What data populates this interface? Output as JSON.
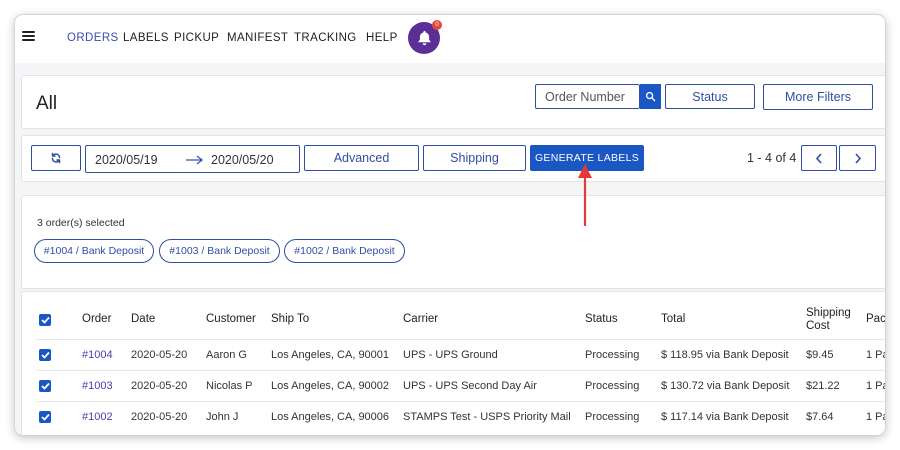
{
  "nav": {
    "items": [
      "ORDERS",
      "LABELS",
      "PICKUP",
      "MANIFEST",
      "TRACKING",
      "HELP"
    ],
    "active": "ORDERS",
    "notification_count": "0",
    "colors": {
      "active": "#3a4db1",
      "bell": "#5b2f97",
      "badge": "#e0483a"
    },
    "icons": {
      "menu": "hamburger-icon",
      "notifications": "bell-icon"
    }
  },
  "header": {
    "title": "All",
    "search_placeholder": "Order Number",
    "status_label": "Status",
    "more_filters_label": "More Filters"
  },
  "toolbar": {
    "date_from": "2020/05/19",
    "date_to": "2020/05/20",
    "advanced_label": "Advanced",
    "shipping_label": "Shipping",
    "generate_label": "GENERATE LABELS",
    "pager": "1 - 4 of 4",
    "colors": {
      "primary": "#1a56c4",
      "border": "#2f4fa3",
      "arrow": "#e53935"
    }
  },
  "selection": {
    "text": "3 order(s) selected",
    "chips": [
      "#1004 / Bank Deposit",
      "#1003 / Bank Deposit",
      "#1002 / Bank Deposit"
    ]
  },
  "table": {
    "headers": [
      "Order",
      "Date",
      "Customer",
      "Ship To",
      "Carrier",
      "Status",
      "Total",
      "Shipping",
      "Cost",
      "Pac"
    ],
    "rows": [
      {
        "order": "#1004",
        "date": "2020-05-20",
        "customer": "Aaron G",
        "ship_to": "Los Angeles, CA, 90001",
        "carrier": "UPS - UPS Ground",
        "status": "Processing",
        "total": "$ 118.95 via Bank Deposit",
        "shipping_cost": "$9.45",
        "package": "1 Pa",
        "checked": true
      },
      {
        "order": "#1003",
        "date": "2020-05-20",
        "customer": "Nicolas P",
        "ship_to": "Los Angeles, CA, 90002",
        "carrier": "UPS - UPS Second Day Air",
        "status": "Processing",
        "total": "$ 130.72 via Bank Deposit",
        "shipping_cost": "$21.22",
        "package": "1 Pa",
        "checked": true
      },
      {
        "order": "#1002",
        "date": "2020-05-20",
        "customer": "John J",
        "ship_to": "Los Angeles, CA, 90006",
        "carrier": "STAMPS Test - USPS Priority Mail",
        "status": "Processing",
        "total": "$ 117.14 via Bank Deposit",
        "shipping_cost": "$7.64",
        "package": "1 Pa",
        "checked": true
      }
    ]
  }
}
